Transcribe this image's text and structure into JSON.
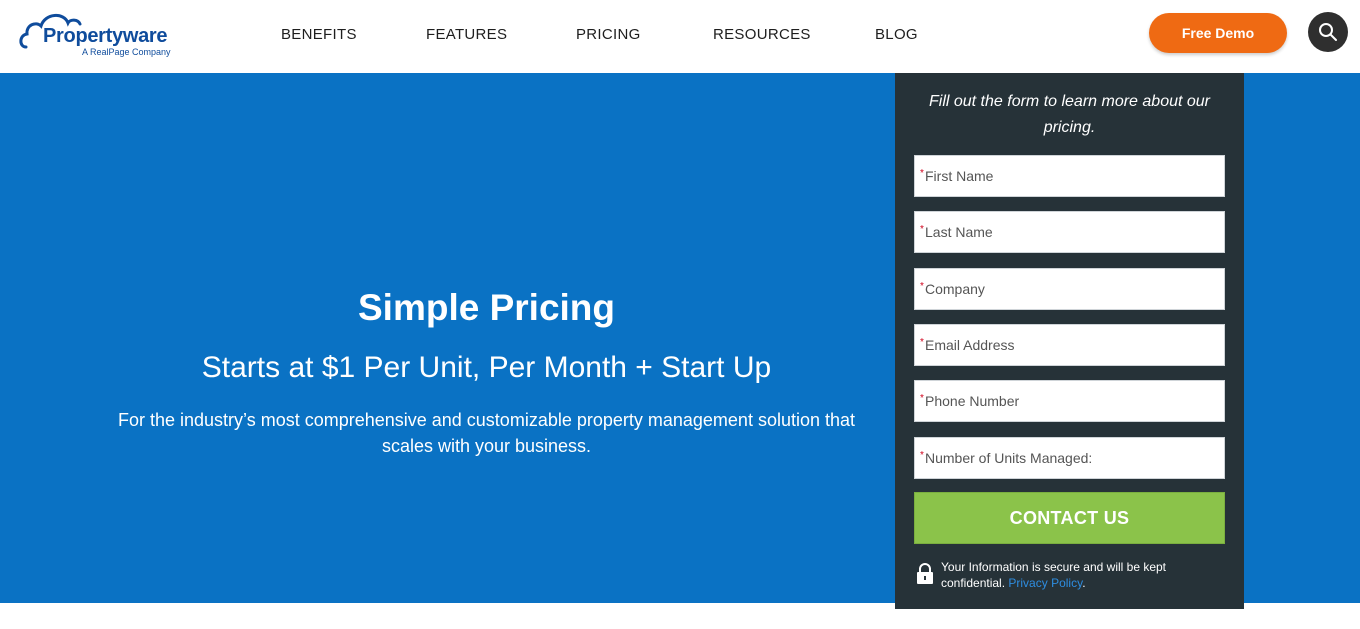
{
  "brand": {
    "name": "Propertyware",
    "tagline": "A RealPage Company",
    "color": "#0f4c9c"
  },
  "nav": {
    "items": [
      {
        "label": "BENEFITS"
      },
      {
        "label": "FEATURES"
      },
      {
        "label": "PRICING"
      },
      {
        "label": "RESOURCES"
      },
      {
        "label": "BLOG"
      }
    ]
  },
  "header": {
    "demo_label": "Free Demo",
    "demo_color": "#ef6a13",
    "search_icon": "search-icon"
  },
  "hero": {
    "title": "Simple Pricing",
    "subtitle": "Starts at $1 Per Unit, Per Month + Start Up",
    "description": "For the industry’s most comprehensive and customizable property management solution that scales with your business.",
    "background": "#0a72c4"
  },
  "form": {
    "intro": "Fill out the form to learn more about our pricing.",
    "required_mark": "*",
    "fields": [
      {
        "placeholder": "First Name",
        "value": ""
      },
      {
        "placeholder": "Last Name",
        "value": ""
      },
      {
        "placeholder": "Company",
        "value": ""
      },
      {
        "placeholder": "Email Address",
        "value": ""
      },
      {
        "placeholder": "Phone Number",
        "value": ""
      },
      {
        "placeholder": "Number of Units Managed:",
        "value": ""
      }
    ],
    "submit_label": "CONTACT US",
    "submit_color": "#8bc34a",
    "secure_text": "Your Information is secure and will be kept confidential.",
    "privacy_link": "Privacy Policy",
    "secure_end": ".",
    "lock_icon": "lock-icon",
    "panel_color": "#263238"
  }
}
